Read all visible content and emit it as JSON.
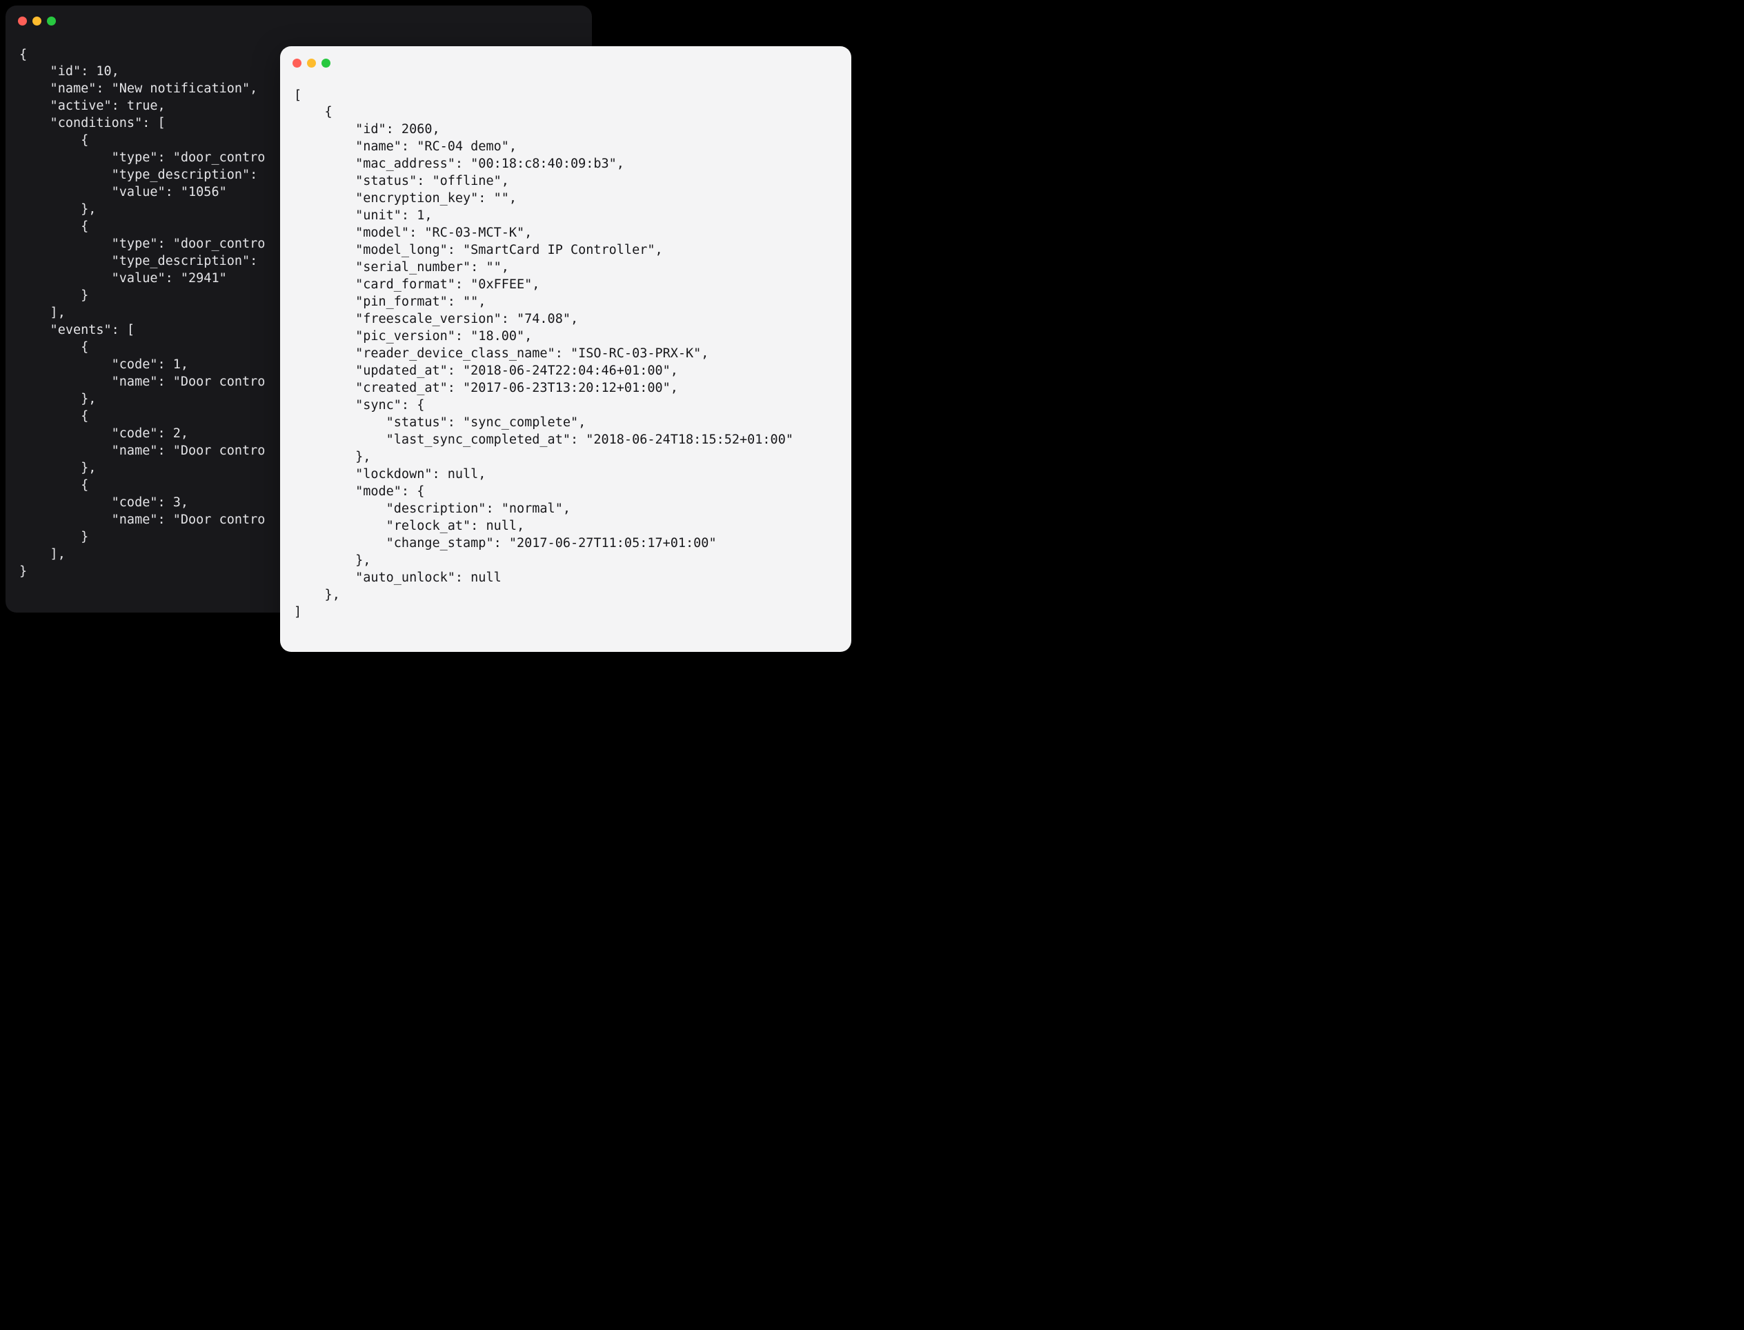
{
  "windows": {
    "dark": {
      "code": "{\n    \"id\": 10,\n    \"name\": \"New notification\",\n    \"active\": true,\n    \"conditions\": [\n        {\n            \"type\": \"door_contro\n            \"type_description\":\n            \"value\": \"1056\"\n        },\n        {\n            \"type\": \"door_contro\n            \"type_description\":\n            \"value\": \"2941\"\n        }\n    ],\n    \"events\": [\n        {\n            \"code\": 1,\n            \"name\": \"Door contro\n        },\n        {\n            \"code\": 2,\n            \"name\": \"Door contro\n        },\n        {\n            \"code\": 3,\n            \"name\": \"Door contro\n        }\n    ],\n}"
    },
    "light": {
      "code": "[\n    {\n        \"id\": 2060,\n        \"name\": \"RC-04 demo\",\n        \"mac_address\": \"00:18:c8:40:09:b3\",\n        \"status\": \"offline\",\n        \"encryption_key\": \"\",\n        \"unit\": 1,\n        \"model\": \"RC-03-MCT-K\",\n        \"model_long\": \"SmartCard IP Controller\",\n        \"serial_number\": \"\",\n        \"card_format\": \"0xFFEE\",\n        \"pin_format\": \"\",\n        \"freescale_version\": \"74.08\",\n        \"pic_version\": \"18.00\",\n        \"reader_device_class_name\": \"ISO-RC-03-PRX-K\",\n        \"updated_at\": \"2018-06-24T22:04:46+01:00\",\n        \"created_at\": \"2017-06-23T13:20:12+01:00\",\n        \"sync\": {\n            \"status\": \"sync_complete\",\n            \"last_sync_completed_at\": \"2018-06-24T18:15:52+01:00\"\n        },\n        \"lockdown\": null,\n        \"mode\": {\n            \"description\": \"normal\",\n            \"relock_at\": null,\n            \"change_stamp\": \"2017-06-27T11:05:17+01:00\"\n        },\n        \"auto_unlock\": null\n    },\n]"
    }
  }
}
